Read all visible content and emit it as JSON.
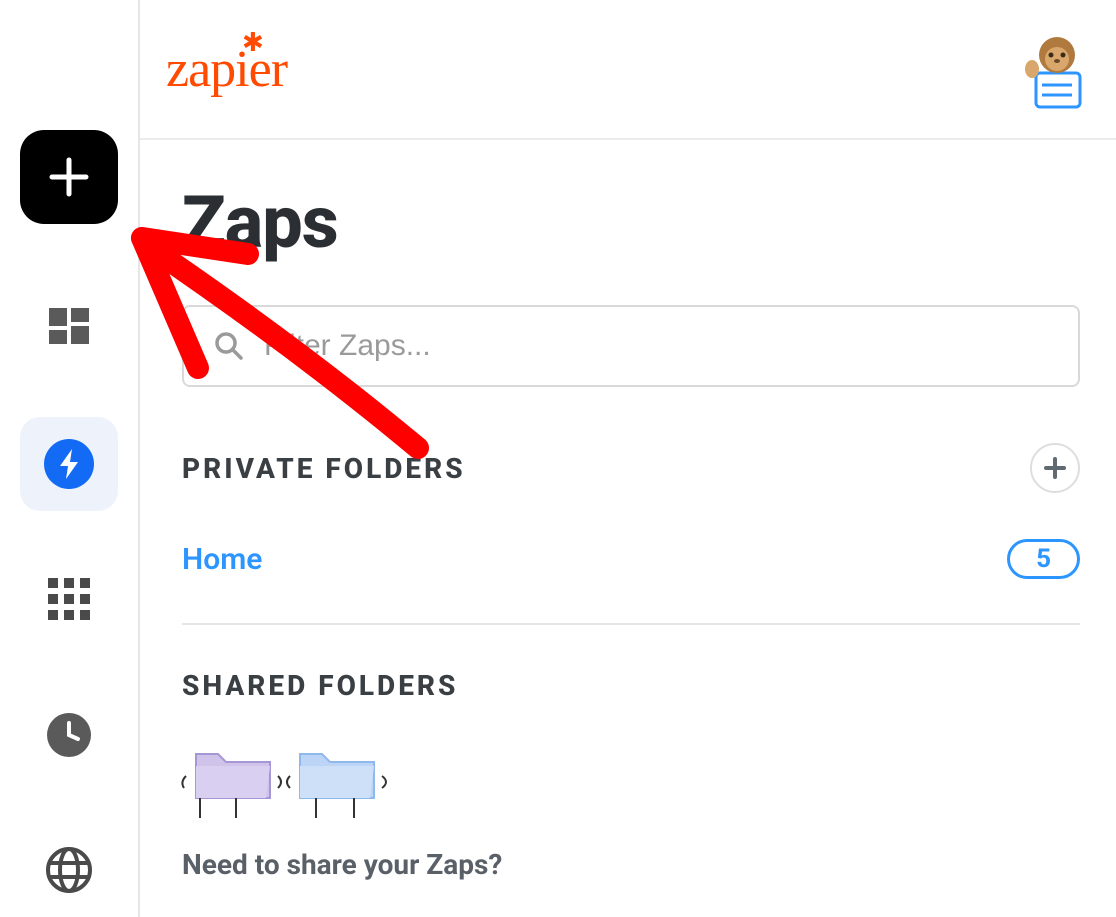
{
  "brand": "zapier",
  "page_title": "Zaps",
  "search": {
    "placeholder": "Filter Zaps..."
  },
  "sections": {
    "private": {
      "title": "PRIVATE FOLDERS",
      "folders": [
        {
          "name": "Home",
          "count": "5"
        }
      ]
    },
    "shared": {
      "title": "SHARED FOLDERS",
      "empty_prompt": "Need to share your Zaps?"
    }
  },
  "colors": {
    "brand_orange": "#ff4a00",
    "link_blue": "#2c95ff",
    "zaps_icon_blue": "#136bf5"
  }
}
